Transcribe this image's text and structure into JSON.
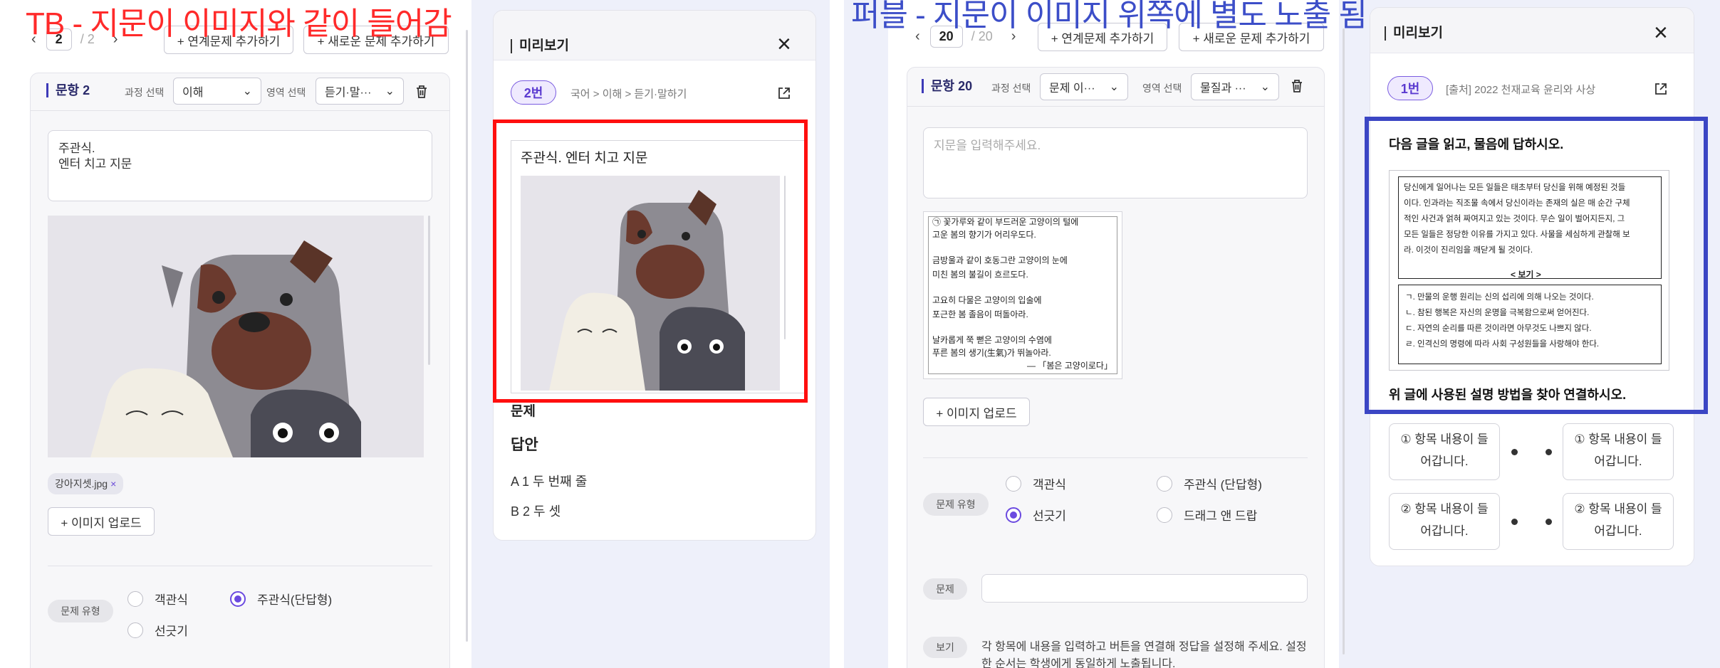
{
  "annotations": {
    "left": "TB - 지문이 이미지와 같이 들어감",
    "right": "퍼블 - 지문이 이미지 위쪽에 별도 노출 됨"
  },
  "tb_editor": {
    "page_current": "2",
    "page_total": "/ 2",
    "add_linked": "+ 연계문제 추가하기",
    "add_new": "+ 새로운 문제 추가하기",
    "q_title": "문항 2",
    "course_label": "과정 선택",
    "course_value": "이해",
    "area_label": "영역 선택",
    "area_value": "듣기·말···",
    "passage_line1": "주관식.",
    "passage_line2": "엔터 치고 지문",
    "file_chip": "강아지셋.jpg",
    "file_remove": "×",
    "upload": "+ 이미지 업로드",
    "type_label": "문제 유형",
    "opt_objective": "객관식",
    "opt_short": "주관식(단답형)",
    "opt_line": "선긋기"
  },
  "tb_preview": {
    "title": "미리보기",
    "num": "2번",
    "crumb": "국어 > 이해 > 듣기·말하기",
    "passage": "주관식. 엔터 치고 지문",
    "question_label": "문제",
    "answer_title": "답안",
    "answers": [
      "A 1 두 번째 줄",
      "B 2 두 셋"
    ]
  },
  "pub_editor": {
    "page_current": "20",
    "page_total": "/ 20",
    "add_linked": "+ 연계문제 추가하기",
    "add_new": "+ 새로운 문제 추가하기",
    "q_title": "문항 20",
    "course_label": "과정 선택",
    "course_value": "문제 이···",
    "area_label": "영역 선택",
    "area_value": "물질과 ···",
    "passage_placeholder": "지문을 입력해주세요.",
    "poem": [
      "㉠ 꽃가루와 같이 부드러운 고양이의 털에",
      "고운 봄의 향기가 어리우도다.",
      "",
      "금방울과 같이 호동그란 고양이의 눈에",
      "미친 봄의 불길이 흐르도다.",
      "",
      "고요히 다물은 고양이의 입술에",
      "포근한 봄 졸음이 떠돌아라.",
      "",
      "날카롭게 쭉 뻗은 고양이의 수염에",
      "푸른 봄의 생기(生氣)가 뛰놀아라.",
      "— 「봄은 고양이로다」"
    ],
    "upload": "+ 이미지 업로드",
    "type_label": "문제 유형",
    "opt_objective": "객관식",
    "opt_short": "주관식 (단답형)",
    "opt_line": "선긋기",
    "opt_drag": "드래그 앤 드랍",
    "question_label": "문제",
    "example_label": "보기",
    "example_text1": "각 항목에 내용을 입력하고 버튼을 연결해 정답을 설정해 주세요. 설정",
    "example_text2": "한 순서는 학생에게 동일하게 노출됩니다."
  },
  "pub_preview": {
    "title": "미리보기",
    "num": "1번",
    "source": "[출처] 2022 천재교육 윤리와 사상",
    "instruction": "다음 글을 읽고, 물음에 답하시오.",
    "passage": [
      "당신에게 일어나는 모든 일들은 태초부터 당신을 위해 예정된 것들",
      "이다. 인과라는 직조물 속에서 당신이라는 존재의 실은 매 순간 구체",
      "적인 사건과 얽혀 짜여지고 있는 것이다. 무슨 일이 벌어지든지, 그",
      "모든 일들은 정당한 이유를 가지고 있다. 사물을 세심하게 관찰해 보",
      "라. 이것이 진리임을 깨닫게 될 것이다."
    ],
    "bogi_title": "< 보기 >",
    "bogi": [
      "ㄱ. 만물의 운행 원리는 신의 섭리에 의해 나오는 것이다.",
      "ㄴ. 참된 행복은 자신의 운명을 극복함으로써 얻어진다.",
      "ㄷ. 자연의 순리를 따른 것이라면 아무것도 나쁘지 않다.",
      "ㄹ. 인격신의 명령에 따라 사회 구성원들을 사랑해야 한다."
    ],
    "question": "위 글에 사용된 설명 방법을 찾아 연결하시오.",
    "items": [
      [
        "① 항목 내용이 들",
        "어갑니다."
      ],
      [
        "② 항목 내용이 들",
        "어갑니다."
      ]
    ]
  }
}
